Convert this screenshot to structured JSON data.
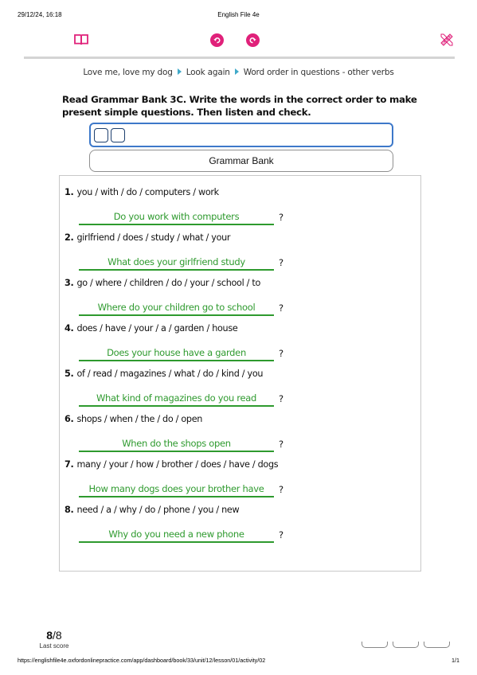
{
  "print_header": {
    "date": "29/12/24, 16:18",
    "title": "English File 4e"
  },
  "toolbar": {
    "icons": [
      "book-icon",
      "undo-icon",
      "redo-icon",
      "pencil-ruler-icon"
    ],
    "colors": {
      "pink": "#e0217a",
      "divider": "#d4d4d4"
    }
  },
  "breadcrumb": [
    "Love me, love my dog",
    "Look again",
    "Word order in questions - other verbs"
  ],
  "instructions": "Read Grammar Bank 3C. Write the words in the correct order to make present simple questions. Then listen and check.",
  "grammar_bank_label": "Grammar Bank",
  "questions": [
    {
      "num": "1.",
      "prompt": "you / with / do / computers / work",
      "answer": "Do you work with computers",
      "mark": "?"
    },
    {
      "num": "2.",
      "prompt": "girlfriend / does / study / what / your",
      "answer": "What does your girlfriend study",
      "mark": "?"
    },
    {
      "num": "3.",
      "prompt": "go / where / children / do / your / school / to",
      "answer": "Where do your children go to school",
      "mark": "?"
    },
    {
      "num": "4.",
      "prompt": "does / have / your / a / garden / house",
      "answer": "Does your house have a garden",
      "mark": "?"
    },
    {
      "num": "5.",
      "prompt": "of / read / magazines / what / do / kind / you",
      "answer": "What kind of magazines do you read",
      "mark": "?"
    },
    {
      "num": "6.",
      "prompt": "shops / when / the / do / open",
      "answer": "When do the shops open",
      "mark": "?"
    },
    {
      "num": "7.",
      "prompt": "many / your / how / brother / does / have / dogs",
      "answer": "How many dogs does your brother have",
      "mark": "?"
    },
    {
      "num": "8.",
      "prompt": "need / a / why / do / phone / you / new",
      "answer": "Why do you need a new phone",
      "mark": "?"
    }
  ],
  "score": {
    "value": "8",
    "total": "/8",
    "label": "Last score"
  },
  "print_footer": {
    "url": "https://englishfile4e.oxfordonlinepractice.com/app/dashboard/book/33/unit/12/lesson/01/activity/02",
    "page": "1/1"
  },
  "colors": {
    "answer_green": "#2e9a2e",
    "audio_border": "#3d78c9",
    "breadcrumb_arrow": "#3fa9c9"
  }
}
